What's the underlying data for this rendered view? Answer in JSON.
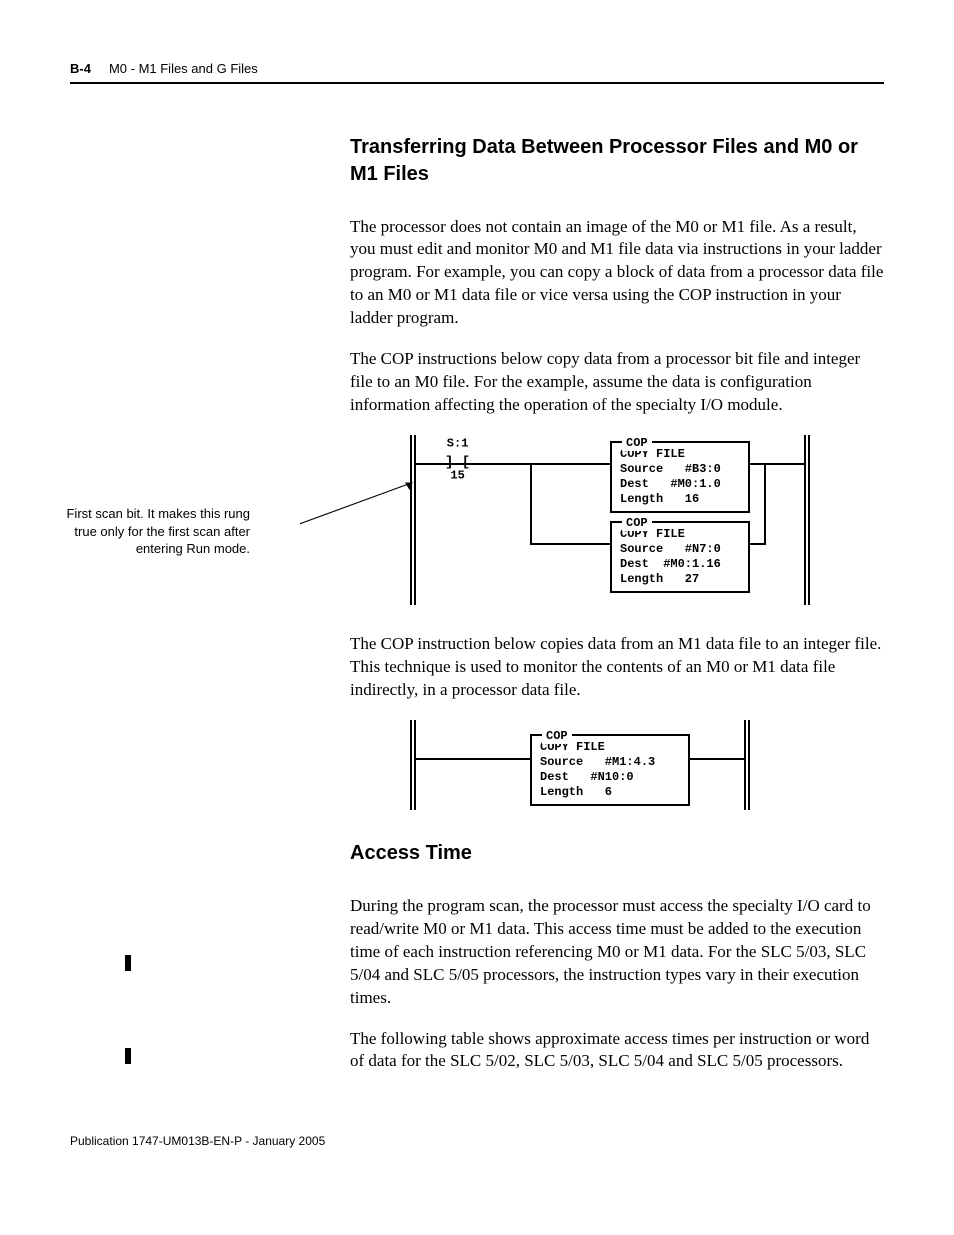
{
  "header": {
    "page": "B-4",
    "title": "M0 - M1 Files and G Files"
  },
  "section1": {
    "heading": "Transferring Data Between Processor Files and M0 or M1 Files",
    "p1": "The processor does not contain an image of the M0 or M1 file. As a result, you must edit and monitor M0 and M1 file data via instructions in your ladder program. For example, you can copy a block of data from a processor data file to an M0 or M1 data file or vice versa using the COP instruction in your ladder program.",
    "p2": "The COP instructions below copy data from a processor bit file and integer file to an M0 file. For the example, assume the data is configuration information affecting the operation of the specialty I/O module."
  },
  "ladder1": {
    "sidenote": "First scan bit.  It makes this rung true only for the first scan after entering Run mode.",
    "contact": {
      "top": "S:1",
      "bit": "15"
    },
    "box1": {
      "mnemonic": "COP",
      "title": "COPY FILE",
      "source": "Source   #B3:0",
      "dest": "Dest   #M0:1.0",
      "length": "Length   16"
    },
    "box2": {
      "mnemonic": "COP",
      "title": "COPY FILE",
      "source": "Source   #N7:0",
      "dest": "Dest  #M0:1.16",
      "length": "Length   27"
    }
  },
  "mid": {
    "p1": "The COP instruction below copies data from an M1 data file to an integer file. This technique is used to monitor the contents of an M0 or M1 data file indirectly, in a processor data file."
  },
  "ladder2": {
    "box": {
      "mnemonic": "COP",
      "title": "COPY FILE",
      "source": "Source   #M1:4.3",
      "dest": "Dest   #N10:0",
      "length": "Length   6"
    }
  },
  "section2": {
    "heading": "Access Time",
    "p1": "During the program scan, the processor must access the specialty I/O card to read/write M0 or M1 data. This access time must be added to the execution time of each instruction referencing M0 or M1 data. For the SLC 5/03, SLC 5/04 and SLC 5/05 processors, the instruction types vary in their execution times.",
    "p2": "The following table shows approximate access times per instruction or word of data for the SLC 5/02, SLC 5/03, SLC 5/04 and SLC 5/05 processors."
  },
  "footer": {
    "pub": "Publication 1747-UM013B-EN-P - January 2005"
  }
}
